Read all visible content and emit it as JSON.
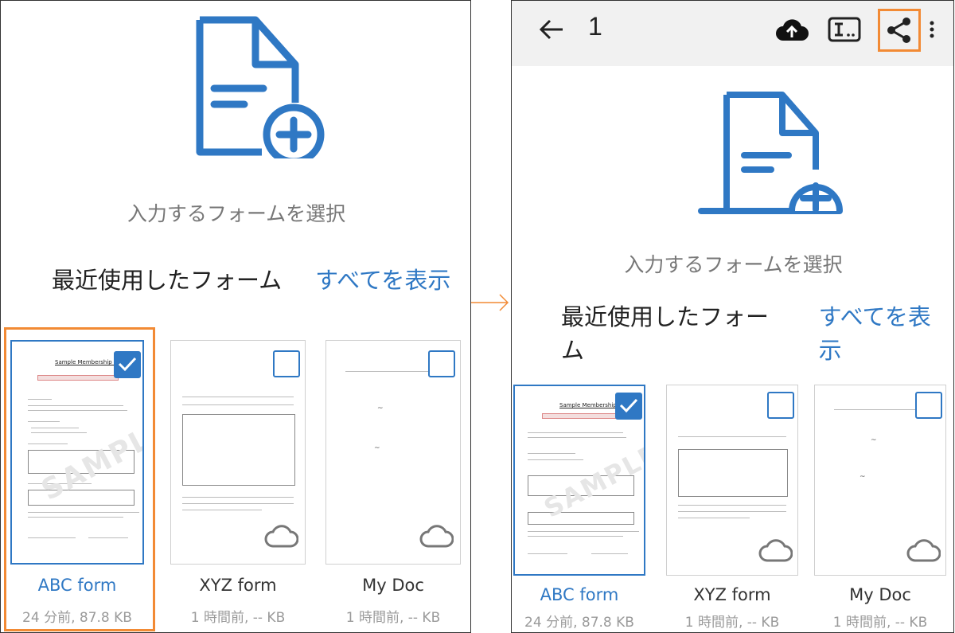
{
  "left": {
    "select_prompt": "入力するフォームを選択",
    "recent_label": "最近使用したフォーム",
    "see_all": "すべてを表示",
    "forms": [
      {
        "name": "ABC form",
        "meta": "24 分前, 87.8 KB",
        "selected": true,
        "thumb_title": "Sample Membership Form",
        "watermark": "SAMPLE"
      },
      {
        "name": "XYZ form",
        "meta": "1 時間前, -- KB",
        "selected": false
      },
      {
        "name": "My Doc",
        "meta": "1 時間前, -- KB",
        "selected": false
      }
    ]
  },
  "right": {
    "appbar": {
      "selected_count": "1",
      "back_icon": "arrow-left-icon",
      "upload_icon": "cloud-upload-icon",
      "text_field_icon": "text-field-icon",
      "share_icon": "share-icon",
      "more_icon": "more-vert-icon"
    },
    "select_prompt": "入力するフォームを選択",
    "recent_label": "最近使用したフォーム",
    "see_all": "すべてを表示",
    "forms": [
      {
        "name": "ABC form",
        "meta": "24 分前, 87.8 KB",
        "selected": true,
        "thumb_title": "Sample Membership Form",
        "watermark": "SAMPLE"
      },
      {
        "name": "XYZ form",
        "meta": "1 時間前, -- KB",
        "selected": false
      },
      {
        "name": "My Doc",
        "meta": "1 時間前, -- KB",
        "selected": false
      }
    ]
  },
  "colors": {
    "accent": "#2f78c4",
    "highlight": "#f28a34"
  }
}
